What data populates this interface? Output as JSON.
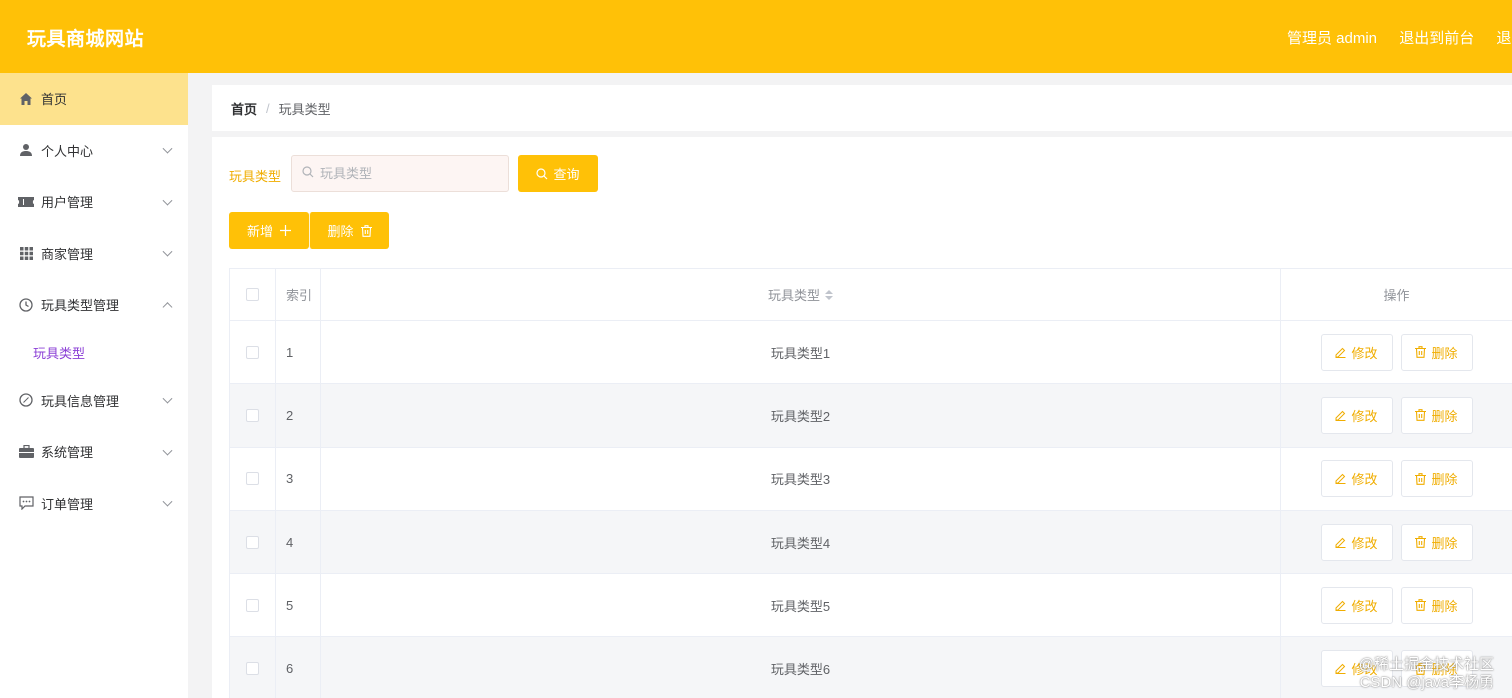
{
  "header": {
    "site_title": "玩具商城网站",
    "admin_label": "管理员 admin",
    "front_link": "退出到前台",
    "logout_link": "退出登录"
  },
  "sidebar": {
    "items": [
      {
        "label": "首页",
        "icon": "home-icon"
      },
      {
        "label": "个人中心",
        "icon": "user-icon"
      },
      {
        "label": "用户管理",
        "icon": "ticket-icon"
      },
      {
        "label": "商家管理",
        "icon": "grid-icon"
      },
      {
        "label": "玩具类型管理",
        "icon": "clock-icon"
      },
      {
        "label": "玩具信息管理",
        "icon": "compass-icon"
      },
      {
        "label": "系统管理",
        "icon": "briefcase-icon"
      },
      {
        "label": "订单管理",
        "icon": "chat-icon"
      }
    ],
    "sub_item": "玩具类型"
  },
  "breadcrumb": {
    "home": "首页",
    "separator": "/",
    "current": "玩具类型"
  },
  "search": {
    "label": "玩具类型",
    "placeholder": "玩具类型",
    "button": "查询"
  },
  "actions": {
    "add": "新增",
    "delete": "删除"
  },
  "table": {
    "headers": {
      "index": "索引",
      "type": "玩具类型",
      "ops": "操作"
    },
    "edit_label": "修改",
    "delete_label": "删除",
    "rows": [
      {
        "index": "1",
        "type": "玩具类型1"
      },
      {
        "index": "2",
        "type": "玩具类型2"
      },
      {
        "index": "3",
        "type": "玩具类型3"
      },
      {
        "index": "4",
        "type": "玩具类型4"
      },
      {
        "index": "5",
        "type": "玩具类型5"
      },
      {
        "index": "6",
        "type": "玩具类型6"
      }
    ]
  },
  "watermark": {
    "line1": "@稀土掘金技术社区",
    "line2": "CSDN @java李杨勇"
  },
  "colors": {
    "primary": "#ffc107",
    "active_menu_bg": "#fde28d",
    "submenu_text": "#8b3fd6",
    "link_text": "#f0ad00"
  }
}
